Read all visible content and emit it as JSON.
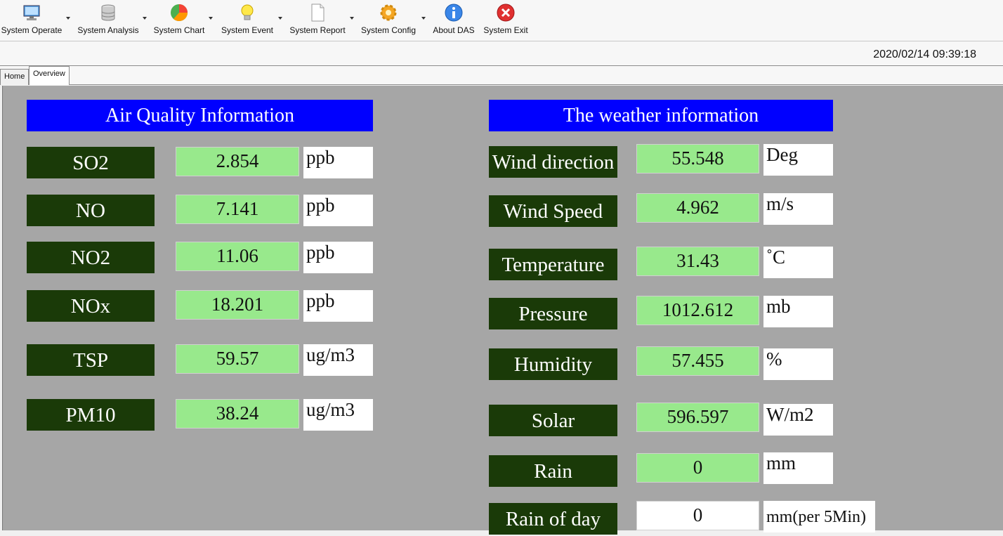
{
  "toolbar": {
    "items": [
      {
        "label": "System Operate",
        "icon": "monitor-icon"
      },
      {
        "label": "System Analysis",
        "icon": "database-icon"
      },
      {
        "label": "System Chart",
        "icon": "pie-chart-icon"
      },
      {
        "label": "System  Event",
        "icon": "lightbulb-icon"
      },
      {
        "label": "System Report",
        "icon": "document-icon"
      },
      {
        "label": "System Config",
        "icon": "gear-icon"
      },
      {
        "label": "About DAS",
        "icon": "info-icon"
      },
      {
        "label": "System Exit",
        "icon": "close-icon"
      }
    ]
  },
  "status": {
    "datetime": "2020/02/14 09:39:18"
  },
  "tabs": [
    {
      "label": "Home"
    },
    {
      "label": "Overview",
      "active": true
    }
  ],
  "air": {
    "title": "Air Quality Information",
    "rows": [
      {
        "name": "SO2",
        "value": "2.854",
        "unit": "ppb"
      },
      {
        "name": "NO",
        "value": "7.141",
        "unit": "ppb"
      },
      {
        "name": "NO2",
        "value": "11.06",
        "unit": "ppb"
      },
      {
        "name": "NOx",
        "value": "18.201",
        "unit": "ppb"
      },
      {
        "name": "TSP",
        "value": "59.57",
        "unit": "ug/m3"
      },
      {
        "name": "PM10",
        "value": "38.24",
        "unit": "ug/m3"
      }
    ]
  },
  "weather": {
    "title": "The weather information",
    "rows": [
      {
        "name": "Wind direction",
        "value": "55.548",
        "unit": "Deg"
      },
      {
        "name": "Wind Speed",
        "value": "4.962",
        "unit": "m/s"
      },
      {
        "name": "Temperature",
        "value": "31.43",
        "unit": "˚C"
      },
      {
        "name": "Pressure",
        "value": "1012.612",
        "unit": "mb"
      },
      {
        "name": "Humidity",
        "value": "57.455",
        "unit": "%"
      },
      {
        "name": "Solar",
        "value": "596.597",
        "unit": "W/m2"
      },
      {
        "name": "Rain",
        "value": "0",
        "unit": "mm"
      },
      {
        "name": "Rain of day",
        "value": "0",
        "unit": "mm(per 5Min)"
      }
    ]
  },
  "colors": {
    "header_bg": "#0000ff",
    "label_bg": "#1a3a08",
    "value_bg": "#98e98c",
    "panel_bg": "#a6a6a6"
  }
}
